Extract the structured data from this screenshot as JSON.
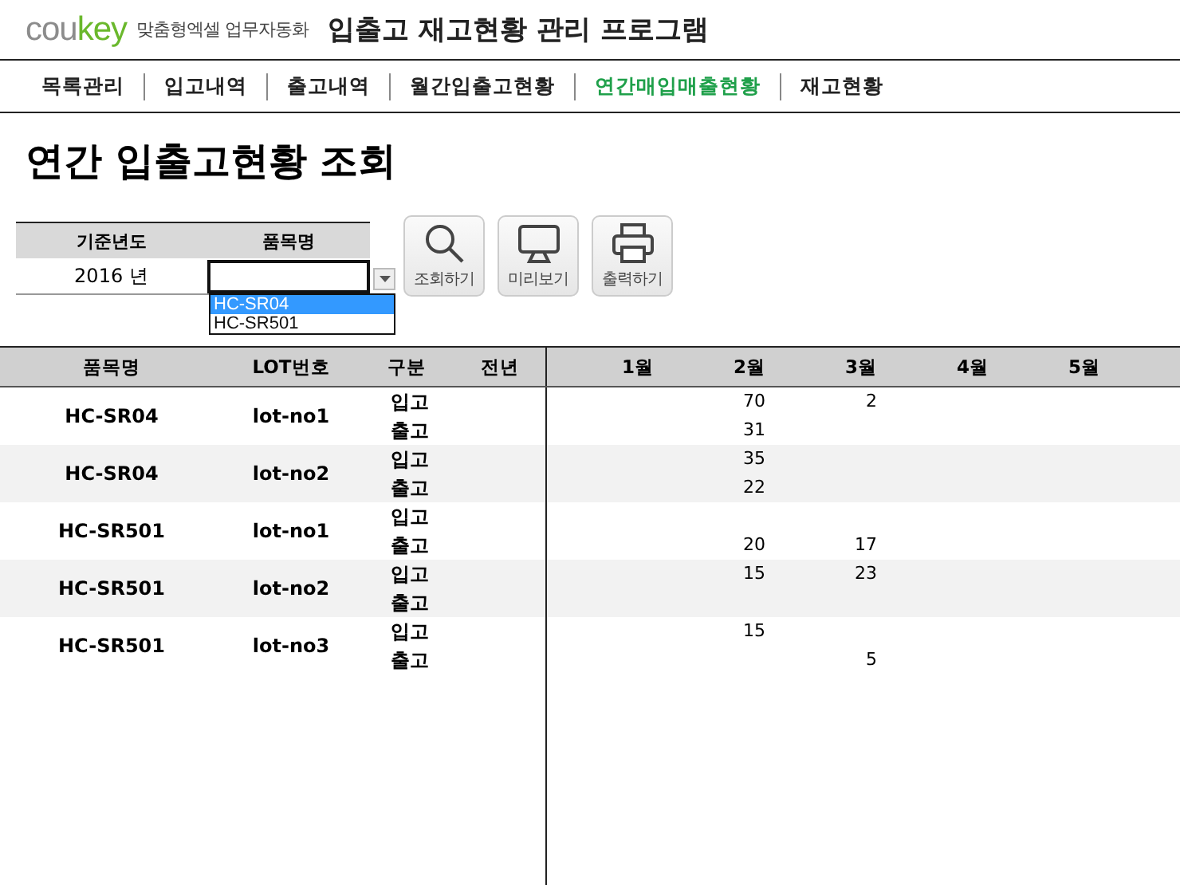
{
  "header": {
    "logo": {
      "muted_part": "cou",
      "accent_part": "key"
    },
    "tagline": "맞춤형엑셀 업무자동화",
    "title": "입출고 재고현황 관리 프로그램"
  },
  "nav": [
    {
      "label": "목록관리",
      "selected": false
    },
    {
      "label": "입고내역",
      "selected": false
    },
    {
      "label": "출고내역",
      "selected": false
    },
    {
      "label": "월간입출고현황",
      "selected": false
    },
    {
      "label": "연간매입매출현황",
      "selected": true
    },
    {
      "label": "재고현황",
      "selected": false
    }
  ],
  "page_title": "연간 입출고현황 조회",
  "filter": {
    "year_label": "기준년도",
    "item_label": "품목명",
    "year_value": "2016 년",
    "dropdown": [
      {
        "label": "HC-SR04",
        "selected": true
      },
      {
        "label": "HC-SR501",
        "selected": false
      }
    ]
  },
  "buttons": [
    {
      "kind": "search",
      "label": "조회하기"
    },
    {
      "kind": "preview",
      "label": "미리보기"
    },
    {
      "kind": "print",
      "label": "출력하기"
    }
  ],
  "table": {
    "columns": [
      "품목명",
      "LOT번호",
      "구분",
      "전년"
    ],
    "months": [
      "1월",
      "2월",
      "3월",
      "4월",
      "5월"
    ],
    "rows": [
      {
        "item": "HC-SR04",
        "lot": "lot-no1",
        "in": {
          "label": "입고",
          "m2": "70",
          "m3": "2"
        },
        "out": {
          "label": "출고",
          "m2": "31"
        }
      },
      {
        "item": "HC-SR04",
        "lot": "lot-no2",
        "in": {
          "label": "입고",
          "m2": "35"
        },
        "out": {
          "label": "출고",
          "m2": "22"
        }
      },
      {
        "item": "HC-SR501",
        "lot": "lot-no1",
        "in": {
          "label": "입고"
        },
        "out": {
          "label": "출고",
          "m2": "20",
          "m3": "17"
        }
      },
      {
        "item": "HC-SR501",
        "lot": "lot-no2",
        "in": {
          "label": "입고",
          "m2": "15",
          "m3": "23"
        },
        "out": {
          "label": "출고"
        }
      },
      {
        "item": "HC-SR501",
        "lot": "lot-no3",
        "in": {
          "label": "입고",
          "m2": "15"
        },
        "out": {
          "label": "출고",
          "m3": "5"
        }
      }
    ]
  }
}
